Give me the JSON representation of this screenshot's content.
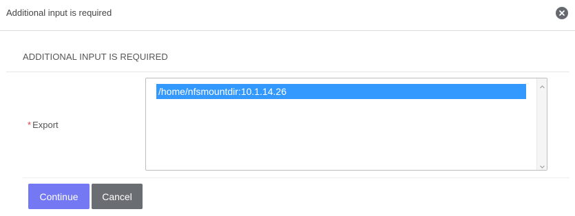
{
  "dialog": {
    "title": "Additional input is required",
    "close_icon": "close-icon"
  },
  "section": {
    "title": "ADDITIONAL INPUT IS REQUIRED"
  },
  "form": {
    "fields": [
      {
        "label": "Export",
        "required_marker": "*",
        "options": [
          "/home/nfsmountdir:10.1.14.26"
        ],
        "selected": "/home/nfsmountdir:10.1.14.26"
      }
    ]
  },
  "actions": {
    "continue_label": "Continue",
    "cancel_label": "Cancel"
  },
  "colors": {
    "continue_bg": "#7479f3",
    "cancel_bg": "#6a6e73",
    "selection_bg": "#3399ff",
    "required": "#e23b3b"
  }
}
